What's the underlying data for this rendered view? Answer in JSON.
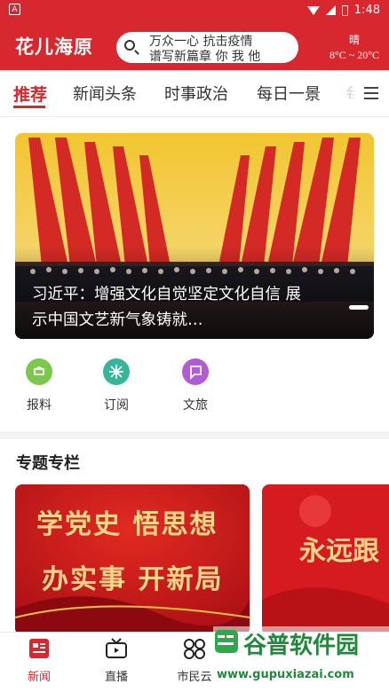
{
  "status_bar": {
    "notification_icon": "A",
    "time": "1:48"
  },
  "header": {
    "app_title": "花儿海原",
    "search_line1": "万众一心 抗击疫情",
    "search_line2": "谱写新篇章 你 我 他",
    "weather_condition": "晴",
    "weather_temp": "8°C ~ 20°C"
  },
  "tabs": [
    {
      "label": "推荐",
      "active": true
    },
    {
      "label": "新闻头条"
    },
    {
      "label": "时事政治"
    },
    {
      "label": "每日一景"
    },
    {
      "label": "每"
    }
  ],
  "banner": {
    "caption": "习近平：增强文化自觉坚定文化自信 展示中国文艺新气象铸就…"
  },
  "quick_links": [
    {
      "label": "报料",
      "icon": "report-icon",
      "color": "#7cc84a"
    },
    {
      "label": "订阅",
      "icon": "subscribe-icon",
      "color": "#37b59b"
    },
    {
      "label": "文旅",
      "icon": "culture-travel-icon",
      "color": "#b45ad6"
    }
  ],
  "section": {
    "title": "专题专栏"
  },
  "cards": [
    {
      "line1": "学党史 悟思想",
      "line2": "办实事 开新局"
    },
    {
      "line1": "永远跟"
    }
  ],
  "bottom_nav": [
    {
      "label": "新闻",
      "icon": "news-icon",
      "active": true
    },
    {
      "label": "直播",
      "icon": "live-tv-icon"
    },
    {
      "label": "市民云",
      "icon": "apps-grid-icon"
    },
    {
      "label": "",
      "icon": "placeholder"
    }
  ],
  "watermark": {
    "title": "谷普软件园",
    "url": "www.gupuxiazai.com"
  },
  "colors": {
    "brand_red": "#d8282f",
    "card_red": "#c4161c"
  }
}
